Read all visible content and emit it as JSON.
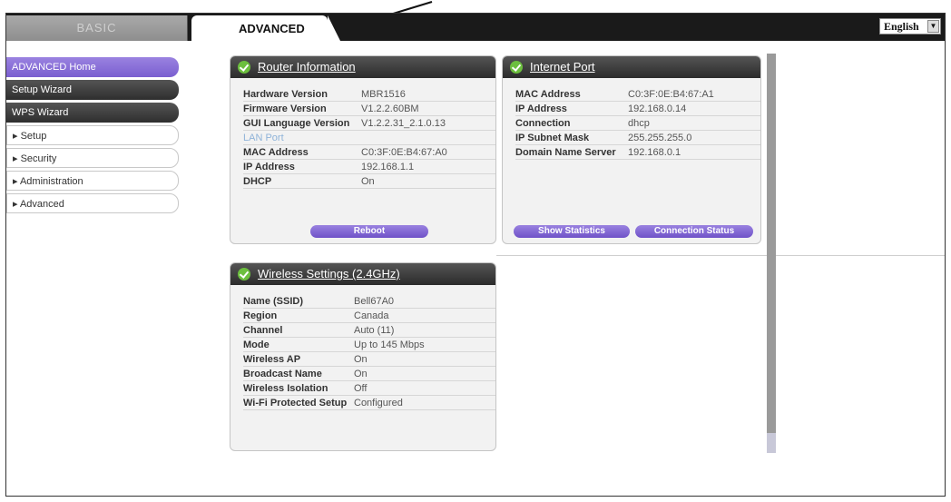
{
  "tabs": {
    "basic": "BASIC",
    "advanced": "ADVANCED"
  },
  "language": {
    "selected": "English"
  },
  "sidebar": {
    "items": [
      {
        "label": "ADVANCED Home",
        "state": "active"
      },
      {
        "label": "Setup Wizard",
        "state": "dark"
      },
      {
        "label": "WPS Wizard",
        "state": "dark"
      },
      {
        "label": "▸ Setup",
        "state": "light"
      },
      {
        "label": "▸ Security",
        "state": "light"
      },
      {
        "label": "▸ Administration",
        "state": "light"
      },
      {
        "label": "▸ Advanced",
        "state": "light"
      }
    ]
  },
  "router": {
    "title": "Router Information",
    "rows": [
      {
        "k": "Hardware Version",
        "v": "MBR1516"
      },
      {
        "k": "Firmware Version",
        "v": "V1.2.2.60BM"
      },
      {
        "k": "GUI Language Version",
        "v": "V1.2.2.31_2.1.0.13"
      },
      {
        "k": "LAN Port",
        "v": ""
      },
      {
        "k": "MAC Address",
        "v": "C0:3F:0E:B4:67:A0"
      },
      {
        "k": "IP Address",
        "v": "192.168.1.1"
      },
      {
        "k": "DHCP",
        "v": "On"
      }
    ],
    "reboot_label": "Reboot"
  },
  "internet": {
    "title": "Internet Port",
    "rows": [
      {
        "k": "MAC Address",
        "v": "C0:3F:0E:B4:67:A1"
      },
      {
        "k": "IP Address",
        "v": "192.168.0.14"
      },
      {
        "k": "Connection",
        "v": "dhcp"
      },
      {
        "k": "IP Subnet Mask",
        "v": "255.255.255.0"
      },
      {
        "k": "Domain Name Server",
        "v": "192.168.0.1"
      }
    ],
    "show_stats_label": "Show Statistics",
    "conn_status_label": "Connection Status"
  },
  "wireless": {
    "title": "Wireless Settings (2.4GHz)",
    "rows": [
      {
        "k": "Name (SSID)",
        "v": "Bell67A0"
      },
      {
        "k": "Region",
        "v": "Canada"
      },
      {
        "k": "Channel",
        "v": "Auto (11)"
      },
      {
        "k": "Mode",
        "v": "Up to 145 Mbps"
      },
      {
        "k": "Wireless AP",
        "v": "On"
      },
      {
        "k": "Broadcast Name",
        "v": "On"
      },
      {
        "k": "Wireless Isolation",
        "v": "Off"
      },
      {
        "k": "Wi-Fi Protected Setup",
        "v": "Configured"
      }
    ]
  },
  "colors": {
    "accent": "#7a5fd0",
    "header": "#2b2b2b",
    "check": "#6cbf3e"
  }
}
